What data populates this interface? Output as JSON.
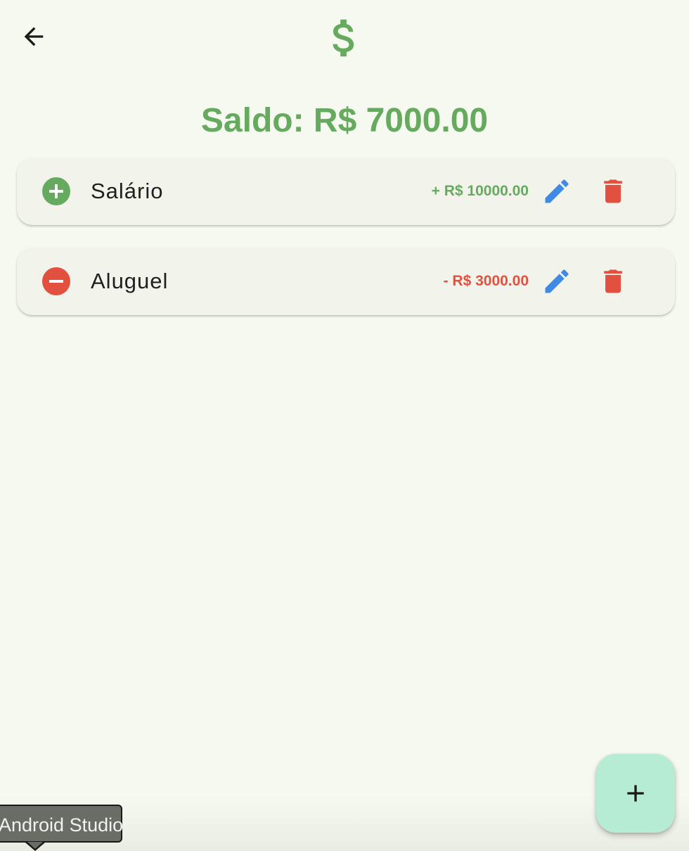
{
  "app_bar": {
    "back_icon": "arrow-back-icon",
    "logo_icon": "dollar-sign-icon",
    "logo_color": "#66aa5f"
  },
  "balance": {
    "text": "Saldo: R$ 7000.00",
    "color": "#66aa5f"
  },
  "transactions": [
    {
      "title": "Salário",
      "amount": "+ R$ 10000.00",
      "type": "income",
      "type_icon": "add-circle-icon",
      "color": "#66aa5f"
    },
    {
      "title": "Aluguel",
      "amount": "- R$ 3000.00",
      "type": "expense",
      "type_icon": "remove-circle-icon",
      "color": "#e2513f"
    }
  ],
  "actions": {
    "edit_icon": "pencil-icon",
    "edit_color": "#3e8ae6",
    "delete_icon": "trash-icon",
    "delete_color": "#e2513f"
  },
  "fab": {
    "icon": "plus-icon",
    "background": "#b7ecd4"
  },
  "tooltip": {
    "text": "Android Studio"
  }
}
